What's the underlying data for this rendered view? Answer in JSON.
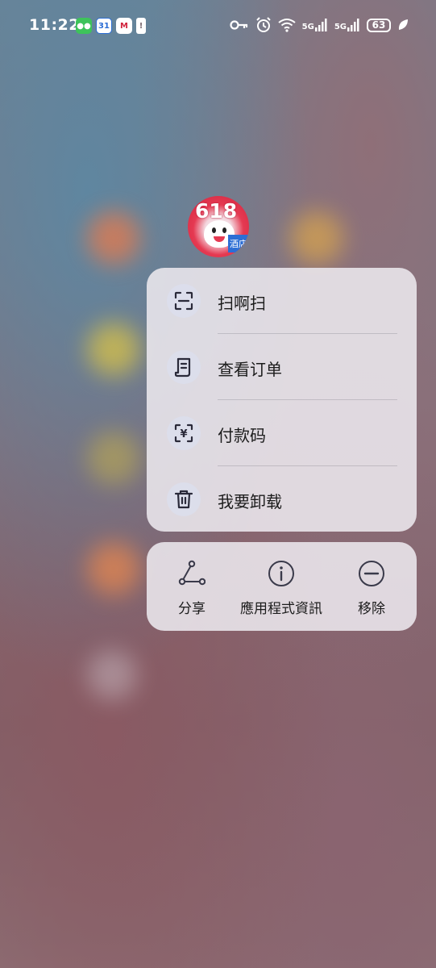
{
  "status_bar": {
    "time": "11:22",
    "battery": "63",
    "network_1": "5G",
    "network_2": "5G",
    "left_icons": [
      "wechat-icon",
      "calendar-icon",
      "metro-app-icon",
      "alert-icon"
    ],
    "right_icons": [
      "key-icon",
      "alarm-icon",
      "wifi-icon",
      "signal-icon",
      "signal-icon",
      "battery-icon",
      "leaf-icon"
    ]
  },
  "app": {
    "badge_number": "618",
    "badge_text": "酒店"
  },
  "menu": {
    "items": [
      {
        "label": "扫啊扫",
        "icon": "scan-icon"
      },
      {
        "label": "查看订单",
        "icon": "order-list-icon"
      },
      {
        "label": "付款码",
        "icon": "payment-code-icon"
      },
      {
        "label": "我要卸载",
        "icon": "trash-icon"
      }
    ]
  },
  "actions": {
    "items": [
      {
        "label": "分享",
        "icon": "share-icon"
      },
      {
        "label": "應用程式資訊",
        "icon": "info-icon"
      },
      {
        "label": "移除",
        "icon": "remove-icon"
      }
    ]
  },
  "colors": {
    "panel_bg": "#ece8ee",
    "text": "#1c1c1c",
    "icon_bg": "#dcdeec"
  }
}
